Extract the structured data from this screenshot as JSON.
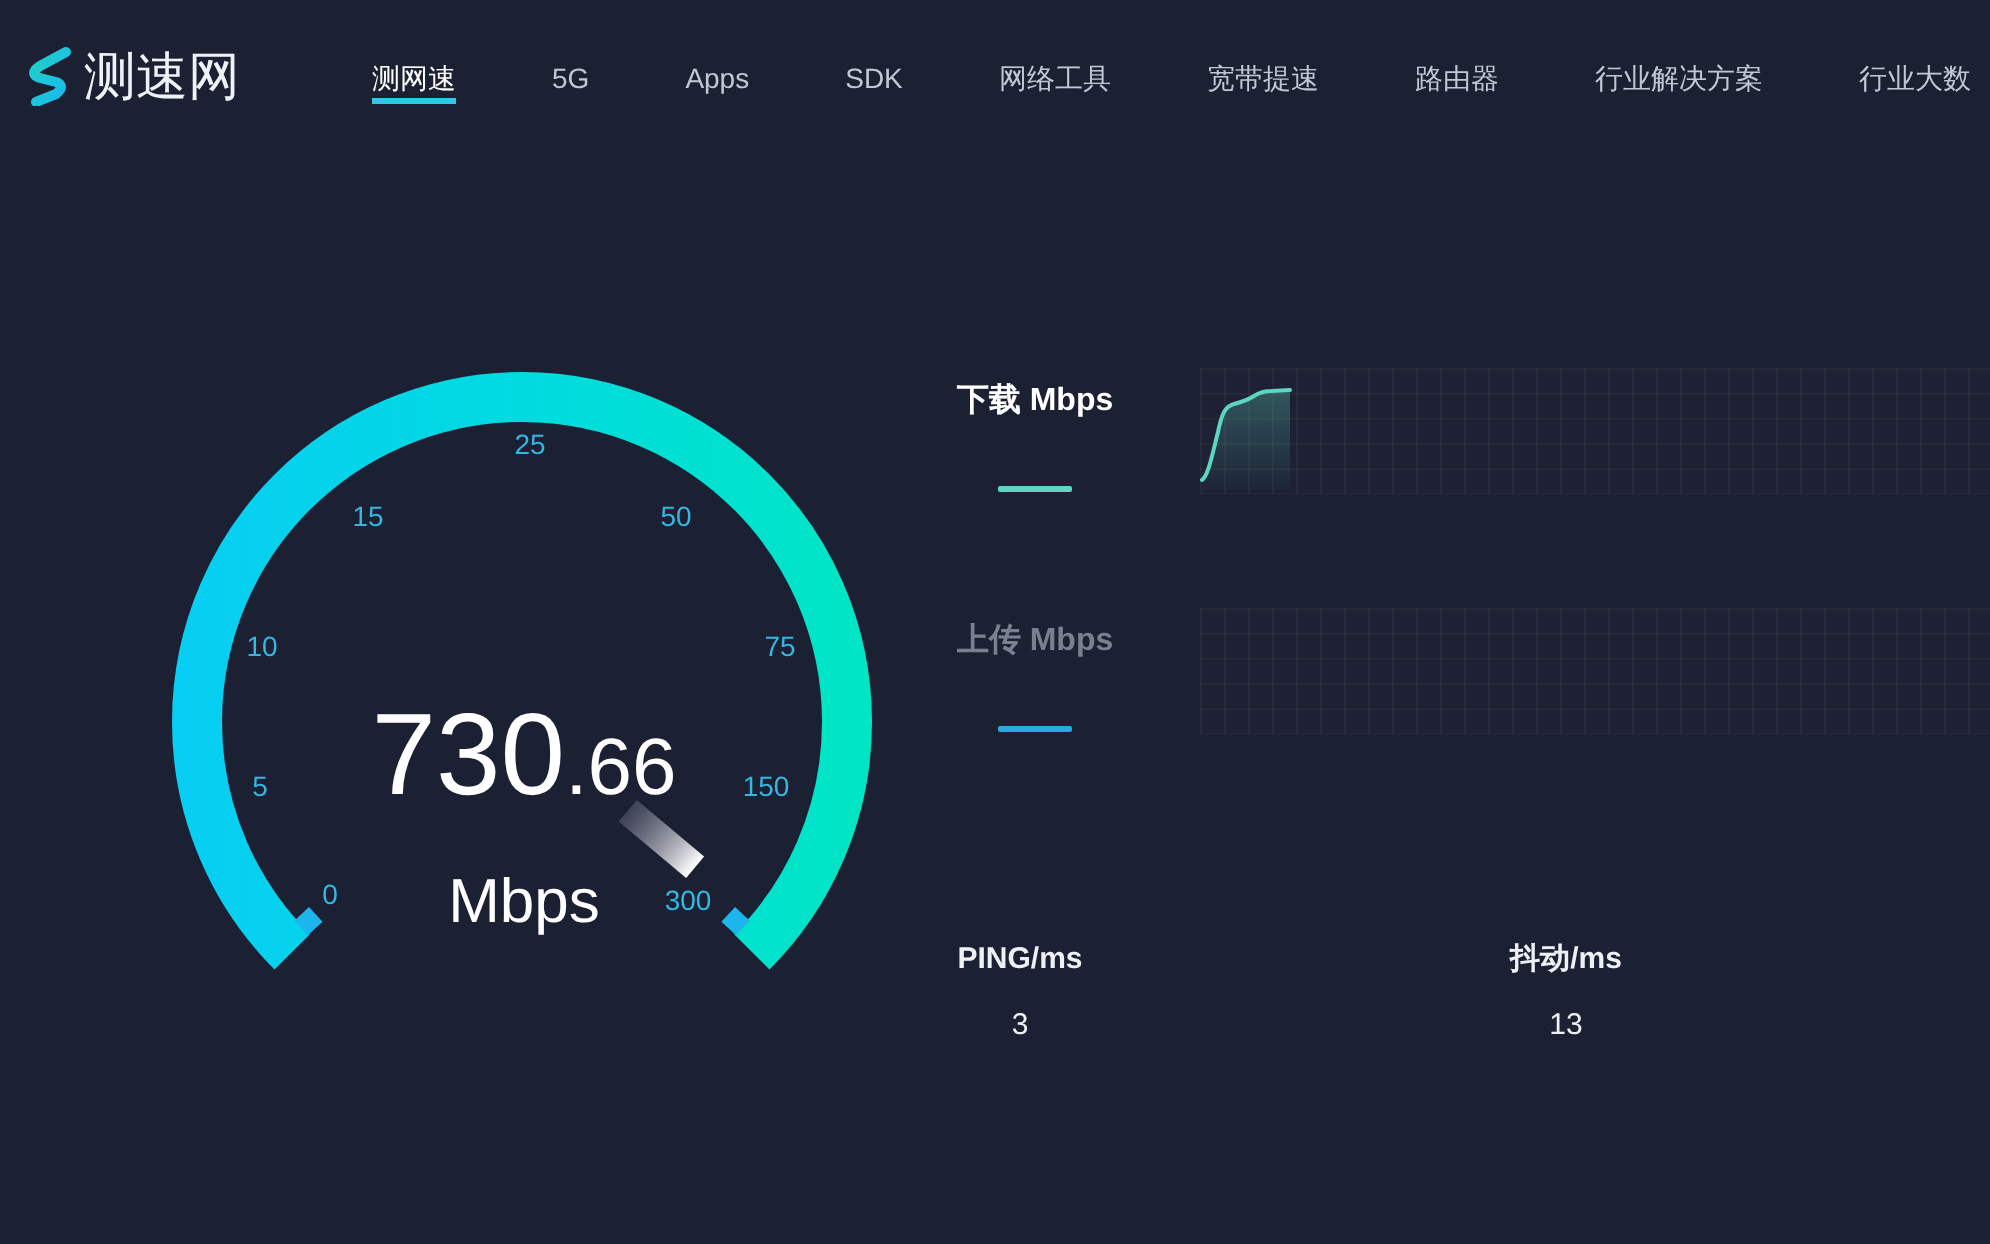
{
  "header": {
    "logo": {
      "text": "测速网"
    },
    "nav": [
      {
        "label": "测网速",
        "selected": true
      },
      {
        "label": "5G",
        "selected": false
      },
      {
        "label": "Apps",
        "selected": false
      },
      {
        "label": "SDK",
        "selected": false
      },
      {
        "label": "网络工具",
        "selected": false
      },
      {
        "label": "宽带提速",
        "selected": false
      },
      {
        "label": "路由器",
        "selected": false
      },
      {
        "label": "行业解决方案",
        "selected": false
      },
      {
        "label": "行业大数",
        "selected": false
      }
    ]
  },
  "gauge": {
    "value": "730.66",
    "unit": "Mbps",
    "level": 1,
    "scale": [
      "0",
      "5",
      "10",
      "15",
      "25",
      "50",
      "75",
      "150",
      "300"
    ]
  },
  "traces": [
    {
      "label": "下载 Mbps",
      "active": true,
      "color": "#5cd6c0"
    },
    {
      "label": "上传 Mbps",
      "active": false,
      "color": "#2aa8e0"
    }
  ],
  "metrics": [
    {
      "label": "PING/ms",
      "value": "3"
    },
    {
      "label": "抖动/ms",
      "value": "13"
    }
  ]
}
